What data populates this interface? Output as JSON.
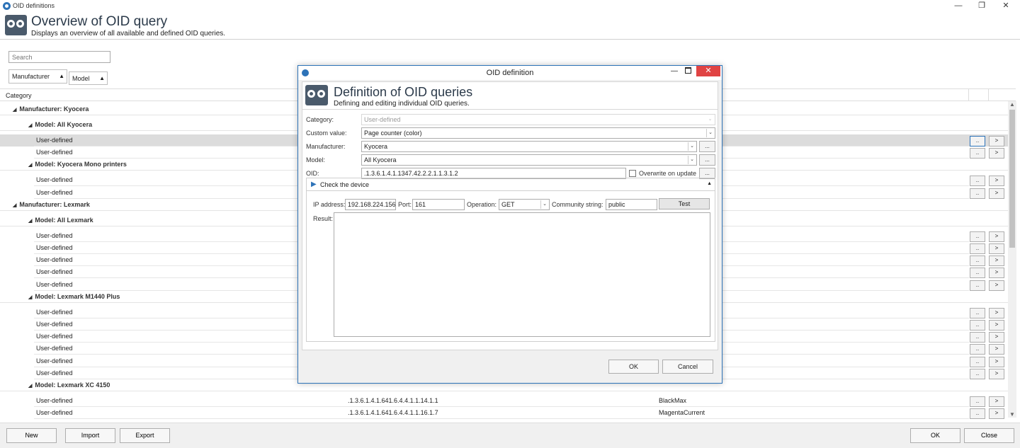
{
  "window": {
    "title": "OID definitions",
    "minimize": "—",
    "restore": "❐",
    "close": "✕"
  },
  "header": {
    "title": "Overview of OID query",
    "subtitle": "Displays an overview of all available and defined OID queries."
  },
  "search": {
    "placeholder": "Search"
  },
  "filters": [
    {
      "label": "Manufacturer",
      "arrow": "▲"
    },
    {
      "label": "Model",
      "arrow": "▲"
    }
  ],
  "grid": {
    "column_category": "Category",
    "row_button_more": "..",
    "row_button_go": ">",
    "rows": [
      {
        "kind": "group",
        "level": 0,
        "label": "Manufacturer: Kyocera"
      },
      {
        "kind": "group",
        "level": 1,
        "label": "Model: All Kyocera"
      },
      {
        "kind": "item",
        "label": "User-defined",
        "selected": true
      },
      {
        "kind": "item",
        "label": "User-defined"
      },
      {
        "kind": "group",
        "level": 1,
        "label": "Model: Kyocera Mono printers"
      },
      {
        "kind": "item",
        "label": "User-defined"
      },
      {
        "kind": "item",
        "label": "User-defined"
      },
      {
        "kind": "group",
        "level": 0,
        "label": "Manufacturer: Lexmark"
      },
      {
        "kind": "group",
        "level": 1,
        "label": "Model: All Lexmark"
      },
      {
        "kind": "item",
        "label": "User-defined"
      },
      {
        "kind": "item",
        "label": "User-defined"
      },
      {
        "kind": "item",
        "label": "User-defined"
      },
      {
        "kind": "item",
        "label": "User-defined"
      },
      {
        "kind": "item",
        "label": "User-defined"
      },
      {
        "kind": "group",
        "level": 1,
        "label": "Model: Lexmark M1440 Plus"
      },
      {
        "kind": "item",
        "label": "User-defined"
      },
      {
        "kind": "item",
        "label": "User-defined"
      },
      {
        "kind": "item",
        "label": "User-defined"
      },
      {
        "kind": "item",
        "label": "User-defined"
      },
      {
        "kind": "item",
        "label": "User-defined"
      },
      {
        "kind": "item",
        "label": "User-defined"
      },
      {
        "kind": "group",
        "level": 1,
        "label": "Model: Lexmark XC 4150"
      },
      {
        "kind": "item",
        "label": "User-defined",
        "oid": ".1.3.6.1.4.1.641.6.4.4.1.1.14.1.1",
        "value": "BlackMax"
      },
      {
        "kind": "item",
        "label": "User-defined",
        "oid": ".1.3.6.1.4.1.641.6.4.4.1.1.16.1.7",
        "value": "MagentaCurrent"
      }
    ]
  },
  "footer": {
    "new": "New",
    "import": "Import",
    "export": "Export",
    "ok": "OK",
    "close": "Close"
  },
  "dialog": {
    "title": "OID definition",
    "min": "—",
    "close": "✕",
    "header_title": "Definition of OID queries",
    "header_subtitle": "Defining and editing individual OID queries.",
    "category_label": "Category:",
    "category_value": "User-defined",
    "custom_value_label": "Custom value:",
    "custom_value_value": "Page counter (color)",
    "manufacturer_label": "Manufacturer:",
    "manufacturer_value": "Kyocera",
    "model_label": "Model:",
    "model_value": "All Kyocera",
    "oid_label": "OID:",
    "oid_value": ".1.3.6.1.4.1.1347.42.2.2.1.1.3.1.2",
    "overwrite_label": "Overwrite on update",
    "edit_button": "...",
    "dropdown_arrow": "⌄",
    "check": {
      "title": "Check the device",
      "play": "▶",
      "collapse": "▲",
      "ip_label": "IP address:",
      "ip_value": "192.168.224.156",
      "port_label": "Port:",
      "port_value": "161",
      "operation_label": "Operation:",
      "operation_value": "GET",
      "community_label": "Community string:",
      "community_value": "public",
      "test_button": "Test",
      "result_label": "Result:"
    },
    "ok": "OK",
    "cancel": "Cancel"
  }
}
